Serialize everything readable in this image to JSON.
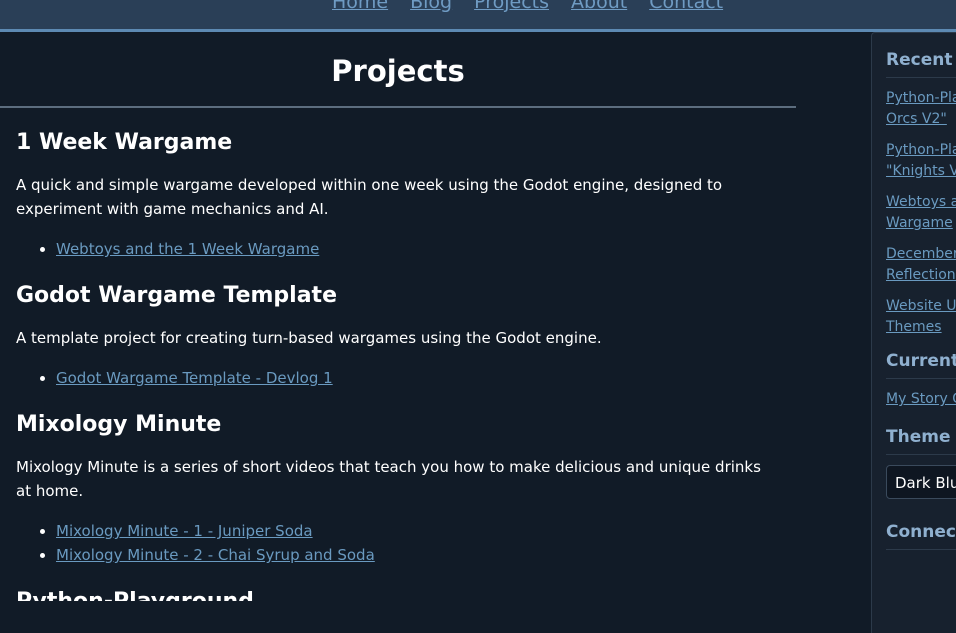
{
  "nav": {
    "items": [
      "Home",
      "Blog",
      "Projects",
      "About",
      "Contact"
    ]
  },
  "page": {
    "title": "Projects"
  },
  "projects": [
    {
      "title": "1 Week Wargame",
      "description": "A quick and simple wargame developed within one week using the Godot engine, designed to experiment with game mechanics and AI.",
      "links": [
        "Webtoys and the 1 Week Wargame"
      ]
    },
    {
      "title": "Godot Wargame Template",
      "description": "A template project for creating turn-based wargames using the Godot engine.",
      "links": [
        "Godot Wargame Template - Devlog 1"
      ]
    },
    {
      "title": "Mixology Minute",
      "description": "Mixology Minute is a series of short videos that teach you how to make delicious and unique drinks at home.",
      "links": [
        "Mixology Minute - 1 - Juniper Soda",
        "Mixology Minute - 2 - Chai Syrup and Soda"
      ]
    },
    {
      "title": "Python-Playground",
      "description": "",
      "links": []
    }
  ],
  "sidebar": {
    "recent_heading": "Recent P",
    "recent_posts": [
      "Python-Pla\nOrcs V2\"",
      "Python-Pla\n\"Knights V",
      "Webtoys a\nWargame",
      "December\nReflections",
      "Website U\nThemes"
    ],
    "currently_heading": "Currently",
    "currently_items": [
      "My Story G"
    ],
    "theme_heading": "Theme",
    "theme_value": "Dark Blue",
    "connect_heading": "Connect"
  }
}
